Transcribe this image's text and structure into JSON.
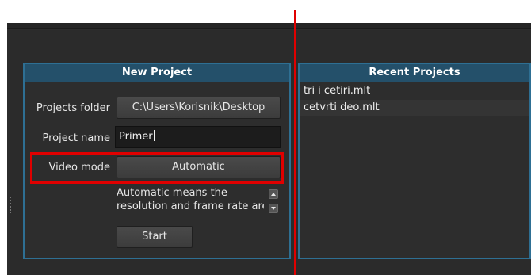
{
  "new_project": {
    "header": "New Project",
    "projects_folder_label": "Projects folder",
    "projects_folder_value": "C:\\Users\\Korisnik\\Desktop",
    "project_name_label": "Project name",
    "project_name_value": "Primer",
    "video_mode_label": "Video mode",
    "video_mode_value": "Automatic",
    "help_line_1": "Automatic means the",
    "help_line_2": "resolution and frame rate are",
    "start_label": "Start"
  },
  "recent_projects": {
    "header": "Recent Projects",
    "items": [
      "tri i cetiri.mlt",
      "cetvrti deo.mlt"
    ]
  },
  "colors": {
    "background": "#2b2b2b",
    "panel_border": "#2e6f93",
    "panel_header": "#24506a",
    "annotation_red": "#e00000"
  },
  "icons": [
    "scroll-up-icon",
    "scroll-down-icon",
    "splitter-grip-icon"
  ]
}
